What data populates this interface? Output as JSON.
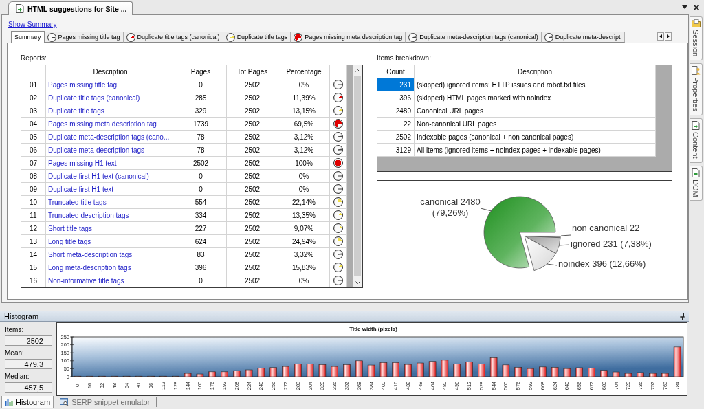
{
  "document_tab": {
    "title": "HTML suggestions for Site ..."
  },
  "summary": {
    "show_summary_link": "Show Summary",
    "tabs": [
      {
        "label": "Summary",
        "selected": true
      },
      {
        "label": "Pages missing title tag",
        "selected": false,
        "kind": "empty"
      },
      {
        "label": "Duplicate title tags (canonical)",
        "selected": false,
        "kind": "eighth",
        "color": "#e00000"
      },
      {
        "label": "Duplicate title tags",
        "selected": false,
        "kind": "eighth",
        "color": "#f2e04a"
      },
      {
        "label": "Pages missing meta description tag",
        "selected": false,
        "kind": "most",
        "color": "#e00000"
      },
      {
        "label": "Duplicate meta-description tags (canonical)",
        "selected": false,
        "kind": "sliver"
      },
      {
        "label": "Duplicate meta-descripti",
        "selected": false,
        "kind": "sliver"
      }
    ],
    "reports": {
      "label": "Reports:",
      "columns": [
        "Description",
        "Pages",
        "Tot Pages",
        "Percentage"
      ],
      "rows": [
        {
          "number": "01",
          "description": "Pages missing title tag",
          "pages": "0",
          "tot_pages": "2502",
          "percentage": "0%",
          "kind": "empty"
        },
        {
          "number": "02",
          "description": "Duplicate title tags (canonical)",
          "pages": "285",
          "tot_pages": "2502",
          "percentage": "11,39%",
          "kind": "eighth",
          "color": "#e00000"
        },
        {
          "number": "03",
          "description": "Duplicate title tags",
          "pages": "329",
          "tot_pages": "2502",
          "percentage": "13,15%",
          "kind": "eighth",
          "color": "#f2e04a"
        },
        {
          "number": "04",
          "description": "Pages missing meta description tag",
          "pages": "1739",
          "tot_pages": "2502",
          "percentage": "69,5%",
          "kind": "most",
          "color": "#e00000"
        },
        {
          "number": "05",
          "description": "Duplicate meta-description tags (cano...",
          "pages": "78",
          "tot_pages": "2502",
          "percentage": "3,12%",
          "kind": "sliver"
        },
        {
          "number": "06",
          "description": "Duplicate meta-description tags",
          "pages": "78",
          "tot_pages": "2502",
          "percentage": "3,12%",
          "kind": "sliver"
        },
        {
          "number": "07",
          "description": "Pages missing H1 text",
          "pages": "2502",
          "tot_pages": "2502",
          "percentage": "100%",
          "kind": "full",
          "color": "#e00000"
        },
        {
          "number": "08",
          "description": "Duplicate first H1 text (canonical)",
          "pages": "0",
          "tot_pages": "2502",
          "percentage": "0%",
          "kind": "empty"
        },
        {
          "number": "09",
          "description": "Duplicate first H1 text",
          "pages": "0",
          "tot_pages": "2502",
          "percentage": "0%",
          "kind": "empty"
        },
        {
          "number": "10",
          "description": "Truncated title tags",
          "pages": "554",
          "tot_pages": "2502",
          "percentage": "22,14%",
          "kind": "quarter",
          "color": "#f2e04a"
        },
        {
          "number": "11",
          "description": "Truncated description tags",
          "pages": "334",
          "tot_pages": "2502",
          "percentage": "13,35%",
          "kind": "eighth",
          "color": "#f2e04a"
        },
        {
          "number": "12",
          "description": "Short title tags",
          "pages": "227",
          "tot_pages": "2502",
          "percentage": "9,07%",
          "kind": "eighth",
          "color": "#f2e04a"
        },
        {
          "number": "13",
          "description": "Long title tags",
          "pages": "624",
          "tot_pages": "2502",
          "percentage": "24,94%",
          "kind": "quarter",
          "color": "#f2e04a"
        },
        {
          "number": "14",
          "description": "Short meta-description tags",
          "pages": "83",
          "tot_pages": "2502",
          "percentage": "3,32%",
          "kind": "sliver"
        },
        {
          "number": "15",
          "description": "Long meta-description tags",
          "pages": "396",
          "tot_pages": "2502",
          "percentage": "15,83%",
          "kind": "sixth",
          "color": "#f2e04a"
        },
        {
          "number": "16",
          "description": "Non-informative title tags",
          "pages": "0",
          "tot_pages": "2502",
          "percentage": "0%",
          "kind": "empty"
        }
      ]
    },
    "items_breakdown": {
      "label": "Items breakdown:",
      "columns": [
        "Count",
        "Description"
      ],
      "rows": [
        {
          "count": "231",
          "description": "(skipped) ignored items: HTTP issues and robot.txt files",
          "selected": true
        },
        {
          "count": "396",
          "description": "(skipped) HTML pages marked with noindex",
          "selected": false
        },
        {
          "count": "2480",
          "description": "Canonical URL pages",
          "selected": false
        },
        {
          "count": "22",
          "description": "Non-canonical URL pages",
          "selected": false
        },
        {
          "count": "2502",
          "description": "Indexable pages (canonical + non canonical pages)",
          "selected": false
        },
        {
          "count": "3129",
          "description": "All items (ignored items + noindex pages + indexable pages)",
          "selected": false
        }
      ]
    },
    "pie_chart": {
      "chart_data": {
        "type": "pie",
        "categories": [
          "canonical",
          "non canonical",
          "ignored",
          "noindex"
        ],
        "values": [
          2480,
          22,
          231,
          396
        ],
        "value_labels": [
          "2480 (79,26%)",
          "22",
          "231 (7,38%)",
          "396 (12,66%)"
        ]
      }
    }
  },
  "dock_tabs": [
    {
      "label": "Session"
    },
    {
      "label": "Properties"
    },
    {
      "label": "Content"
    },
    {
      "label": "DOM"
    }
  ],
  "histogram": {
    "title": "Histogram",
    "stats": [
      {
        "label": "Items:",
        "value": "2502"
      },
      {
        "label": "Mean:",
        "value": "479,3"
      },
      {
        "label": "Median:",
        "value": "457,5"
      }
    ],
    "chart_data": {
      "type": "bar",
      "title": "Title width (pixels)",
      "categories": [
        "0",
        "16",
        "32",
        "48",
        "64",
        "80",
        "96",
        "112",
        "128",
        "144",
        "160",
        "176",
        "192",
        "208",
        "224",
        "240",
        "256",
        "272",
        "288",
        "304",
        "320",
        "336",
        "352",
        "368",
        "384",
        "400",
        "416",
        "432",
        "448",
        "464",
        "480",
        "496",
        "512",
        "528",
        "544",
        "560",
        "576",
        "592",
        "608",
        "624",
        "640",
        "656",
        "672",
        "688",
        "704",
        "720",
        "736",
        "752",
        "768",
        "784"
      ],
      "values": [
        0,
        0,
        0,
        0,
        0,
        0,
        0,
        0,
        0,
        21,
        17,
        31,
        31,
        38,
        43,
        53,
        57,
        64,
        79,
        79,
        76,
        64,
        76,
        100,
        73,
        89,
        89,
        77,
        86,
        96,
        104,
        79,
        93,
        79,
        119,
        74,
        59,
        51,
        61,
        59,
        51,
        56,
        54,
        40,
        30,
        21,
        26,
        21,
        21,
        186
      ],
      "ylim": [
        0,
        250
      ],
      "yticks": [
        0,
        50,
        100,
        150,
        200,
        250
      ]
    }
  },
  "bottom_tabs": [
    {
      "label": "Histogram",
      "selected": true
    },
    {
      "label": "SERP snippet emulator",
      "selected": false
    }
  ]
}
